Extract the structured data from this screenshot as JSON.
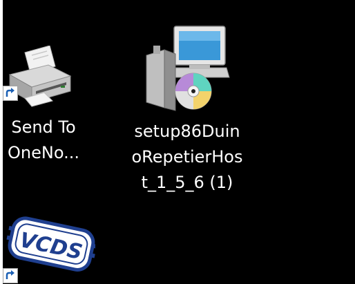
{
  "desktop": {
    "background_color": "#000000",
    "icons": [
      {
        "label": "Send To OneNo...",
        "label_lines": [
          "Send To",
          "OneNo..."
        ],
        "icon": "printer-icon",
        "is_shortcut": true
      },
      {
        "label": "setup86DuinoRepetierHost_1_5_6 (1)",
        "label_lines": [
          "setup86Duin",
          "oRepetierHos",
          "t_1_5_6 (1)"
        ],
        "icon": "installer-icon",
        "is_shortcut": false
      },
      {
        "label": "VCDS",
        "label_lines": [],
        "icon": "vcds-logo-icon",
        "is_shortcut": true
      }
    ]
  }
}
